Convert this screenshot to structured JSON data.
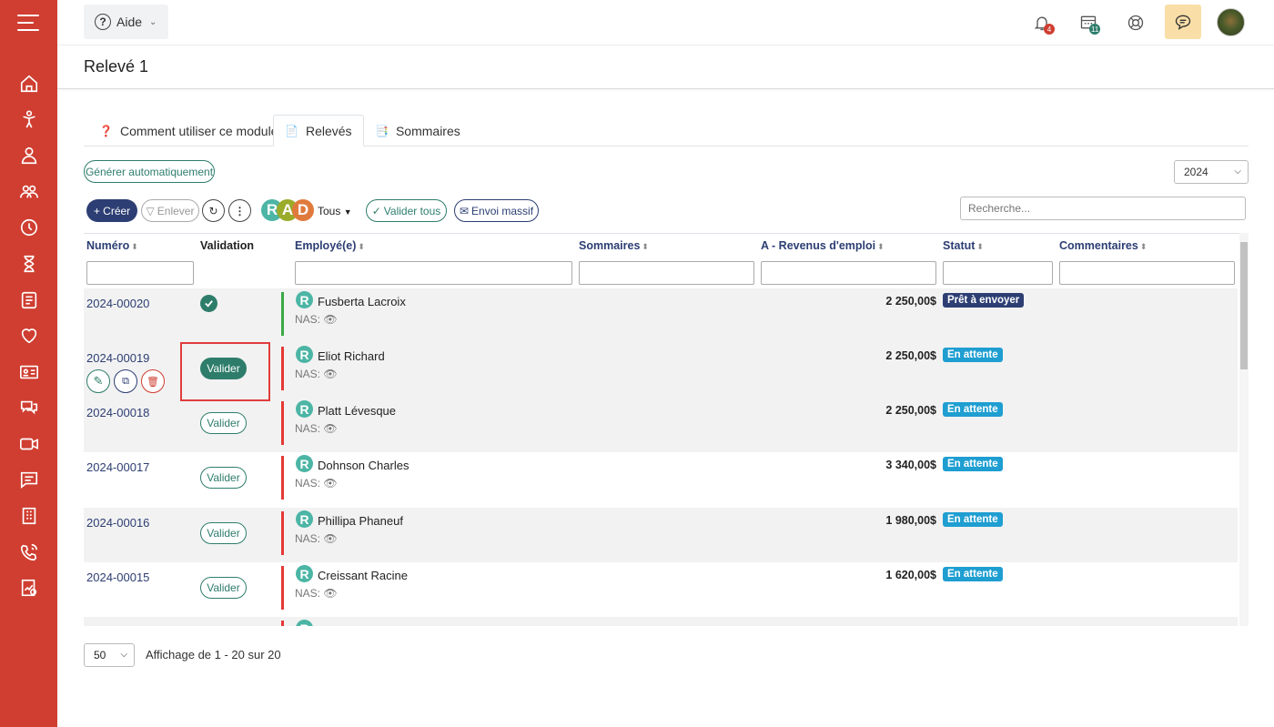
{
  "help": {
    "label": "Aide"
  },
  "notifications": {
    "bell_count": "4",
    "calendar_count": "11"
  },
  "page": {
    "title": "Relevé 1"
  },
  "tabs": [
    {
      "label": "Comment utiliser ce module"
    },
    {
      "label": "Relevés"
    },
    {
      "label": "Sommaires"
    }
  ],
  "toolbar": {
    "generate_label": "Générer automatiquement",
    "year": "2024",
    "create_label": "+ Créer",
    "remove_label": "Enlever",
    "rad_letters": [
      "R",
      "A",
      "D"
    ],
    "filter_label": "Tous",
    "validate_all_label": "Valider tous",
    "bulk_send_label": "Envoi massif",
    "search_placeholder": "Recherche..."
  },
  "table": {
    "columns": {
      "numero": "Numéro",
      "validation": "Validation",
      "employe": "Employé(e)",
      "sommaires": "Sommaires",
      "revenus": "A - Revenus d'emploi",
      "statut": "Statut",
      "commentaires": "Commentaires"
    },
    "nas_label": "NAS:",
    "validate_label": "Valider",
    "rows": [
      {
        "numero": "2024-00020",
        "employe": "Fusberta Lacroix",
        "revenus": "2 250,00$",
        "statut": "Prêt à envoyer",
        "validated": true
      },
      {
        "numero": "2024-00019",
        "employe": "Eliot Richard",
        "revenus": "2 250,00$",
        "statut": "En attente",
        "validated": false
      },
      {
        "numero": "2024-00018",
        "employe": "Platt Lévesque",
        "revenus": "2 250,00$",
        "statut": "En attente",
        "validated": false
      },
      {
        "numero": "2024-00017",
        "employe": "Dohnson Charles",
        "revenus": "3 340,00$",
        "statut": "En attente",
        "validated": false
      },
      {
        "numero": "2024-00016",
        "employe": "Phillipa Phaneuf",
        "revenus": "1 980,00$",
        "statut": "En attente",
        "validated": false
      },
      {
        "numero": "2024-00015",
        "employe": "Creissant Racine",
        "revenus": "1 620,00$",
        "statut": "En attente",
        "validated": false
      }
    ]
  },
  "footer": {
    "page_size": "50",
    "info": "Affichage de 1 - 20 sur 20"
  },
  "colors": {
    "sidebar": "#cf3e31",
    "primary": "#2c3e73",
    "accent": "#2e7d6b",
    "status_ready": "#2c3e73",
    "status_pending": "#1f9ed1",
    "bar_validated": "#3aa845",
    "bar_pending": "#e53935"
  }
}
